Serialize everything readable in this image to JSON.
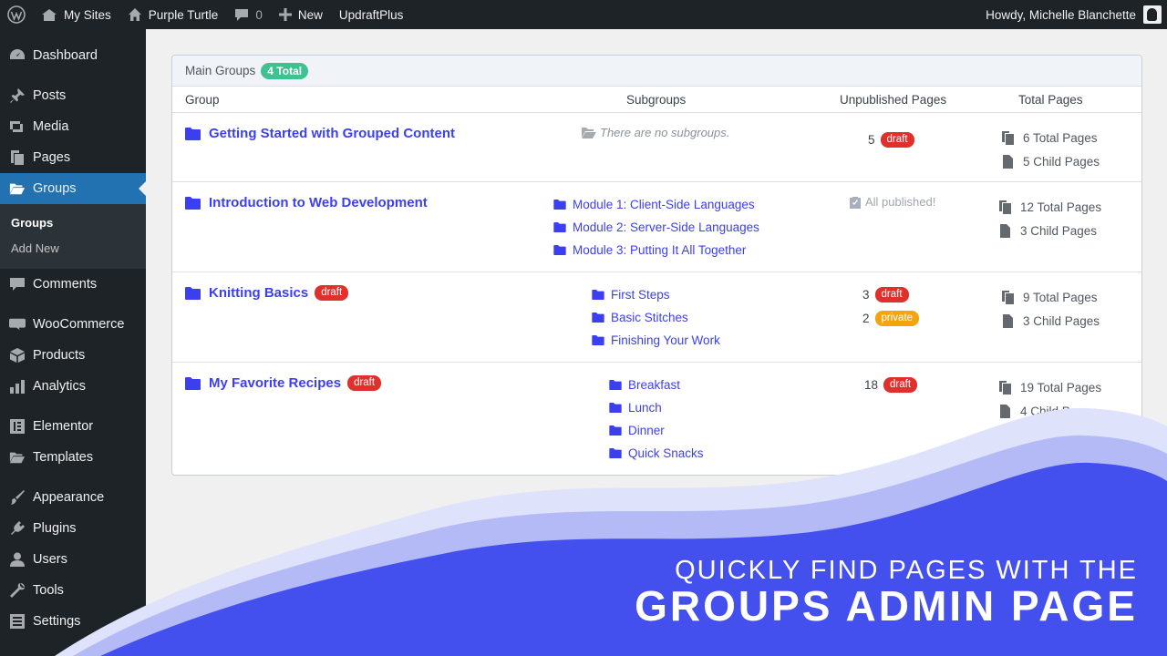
{
  "adminbar": {
    "my_sites": "My Sites",
    "site_name": "Purple Turtle",
    "comments_count": "0",
    "new_label": "New",
    "plugin": "UpdraftPlus",
    "howdy": "Howdy, Michelle Blanchette"
  },
  "sidebar": {
    "dashboard": "Dashboard",
    "posts": "Posts",
    "media": "Media",
    "pages": "Pages",
    "groups": "Groups",
    "sub_groups": "Groups",
    "sub_add_new": "Add New",
    "comments": "Comments",
    "woocommerce": "WooCommerce",
    "products": "Products",
    "analytics": "Analytics",
    "elementor": "Elementor",
    "templates": "Templates",
    "appearance": "Appearance",
    "plugins": "Plugins",
    "users": "Users",
    "tools": "Tools",
    "settings": "Settings"
  },
  "panel": {
    "title": "Main Groups",
    "total_badge": "4 Total",
    "columns": {
      "group": "Group",
      "subgroups": "Subgroups",
      "unpublished": "Unpublished Pages",
      "total": "Total Pages"
    },
    "no_subgroups": "There are no subgroups.",
    "all_published": "All published!",
    "groups": [
      {
        "name": "Getting Started with Grouped Content",
        "unpublished_count": "5",
        "unpublished_status": "draft",
        "total_pages": "6 Total Pages",
        "child_pages": "5 Child Pages"
      },
      {
        "name": "Introduction to Web Development",
        "subgroups": [
          "Module 1: Client-Side Languages",
          "Module 2: Server-Side Languages",
          "Module 3: Putting It All Together"
        ],
        "total_pages": "12 Total Pages",
        "child_pages": "3 Child Pages"
      },
      {
        "name": "Knitting Basics",
        "status": "draft",
        "subgroups": [
          "First Steps",
          "Basic Stitches",
          "Finishing Your Work"
        ],
        "unpublished_count": "3",
        "unpublished_status": "draft",
        "unpublished_count_2": "2",
        "unpublished_status_2": "private",
        "total_pages": "9 Total Pages",
        "child_pages": "3 Child Pages"
      },
      {
        "name": "My Favorite Recipes",
        "status": "draft",
        "subgroups": [
          "Breakfast",
          "Lunch",
          "Dinner",
          "Quick Snacks"
        ],
        "unpublished_count": "18",
        "unpublished_status": "draft",
        "total_pages": "19 Total Pages",
        "child_pages": "4 Child Pages"
      }
    ]
  },
  "banner": {
    "line1": "QUICKLY FIND PAGES WITH THE",
    "line2": "GROUPS ADMIN PAGE"
  },
  "colors": {
    "link": "#3b3ff0",
    "draft": "#e0302c",
    "private": "#f2a60c",
    "wave": "#4450ee",
    "active_menu": "#2271b1"
  }
}
